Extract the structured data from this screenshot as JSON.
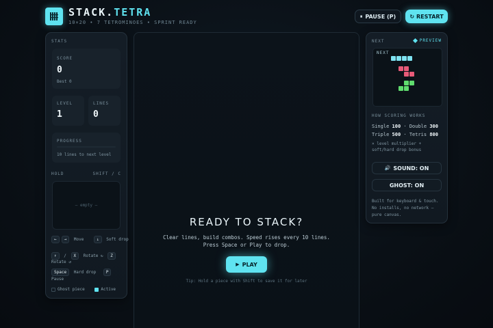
{
  "header": {
    "title_main": "STACK.",
    "title_accent": "TETRA",
    "subtitle": "10×20 • 7 TETROMINOES • SPRINT READY",
    "pause_label": "PAUSE (P)",
    "restart_label": "RESTART",
    "pause_icon": "⏸",
    "restart_icon": "↻"
  },
  "stats": {
    "section_label": "STATS",
    "score_label": "SCORE",
    "score_value": "0",
    "best_text": "Best 0",
    "level_label": "LEVEL",
    "level_value": "1",
    "lines_label": "LINES",
    "lines_value": "0",
    "progress_label": "PROGRESS",
    "progress_text": "10 lines to next level",
    "progress_fraction": 0
  },
  "hold": {
    "label": "HOLD",
    "hotkey": "SHIFT / C",
    "empty_text": "— empty —"
  },
  "controls": {
    "left_key": "←",
    "right_key": "→",
    "move_label": "Move",
    "down_key": "↓",
    "soft_drop_label": "Soft drop",
    "up_key": "↑",
    "slash": "/",
    "x_key": "X",
    "rotate_cw_label": "Rotate ↻",
    "z_key": "Z",
    "rotate_ccw_label": "Rotate ↺",
    "space_key": "Space",
    "hard_drop_label": "Hard drop",
    "p_key": "P",
    "pause_label": "Pause"
  },
  "toggles": {
    "ghost_label": "Ghost piece",
    "active_label": "Active"
  },
  "board": {
    "overlay_title": "READY TO STACK?",
    "overlay_line1": "Clear lines, build combos. Speed rises every 10 lines.",
    "overlay_line2": "Press Space or Play to drop.",
    "play_label": "PLAY",
    "play_icon": "▶",
    "tip": "Tip: Hold a piece with Shift to save it for later"
  },
  "next": {
    "label": "NEXT",
    "preview_label": "PREVIEW",
    "inner_label": "NEXT",
    "pieces": [
      {
        "shape": "I",
        "color": "#7fe3f2"
      },
      {
        "shape": "Z",
        "color": "#e85a78"
      },
      {
        "shape": "S",
        "color": "#5fdc6e"
      }
    ]
  },
  "scoring": {
    "title": "HOW SCORING WORKS",
    "single_label": "Single",
    "single_value": "100",
    "double_label": "Double",
    "double_value": "300",
    "triple_label": "Triple",
    "triple_value": "500",
    "tetris_label": "Tetris",
    "tetris_value": "800",
    "note": "× level multiplier + soft/hard drop bonus",
    "sep": "·"
  },
  "settings": {
    "sound_label": "SOUND: ON",
    "sound_icon": "🔊",
    "ghost_label": "GHOST: ON"
  },
  "footer_note": "Built for keyboard & touch. No installs, no network — pure canvas.",
  "colors": {
    "accent": "#5fe3f0",
    "background": "#0a1016",
    "panel": "#141d26"
  }
}
